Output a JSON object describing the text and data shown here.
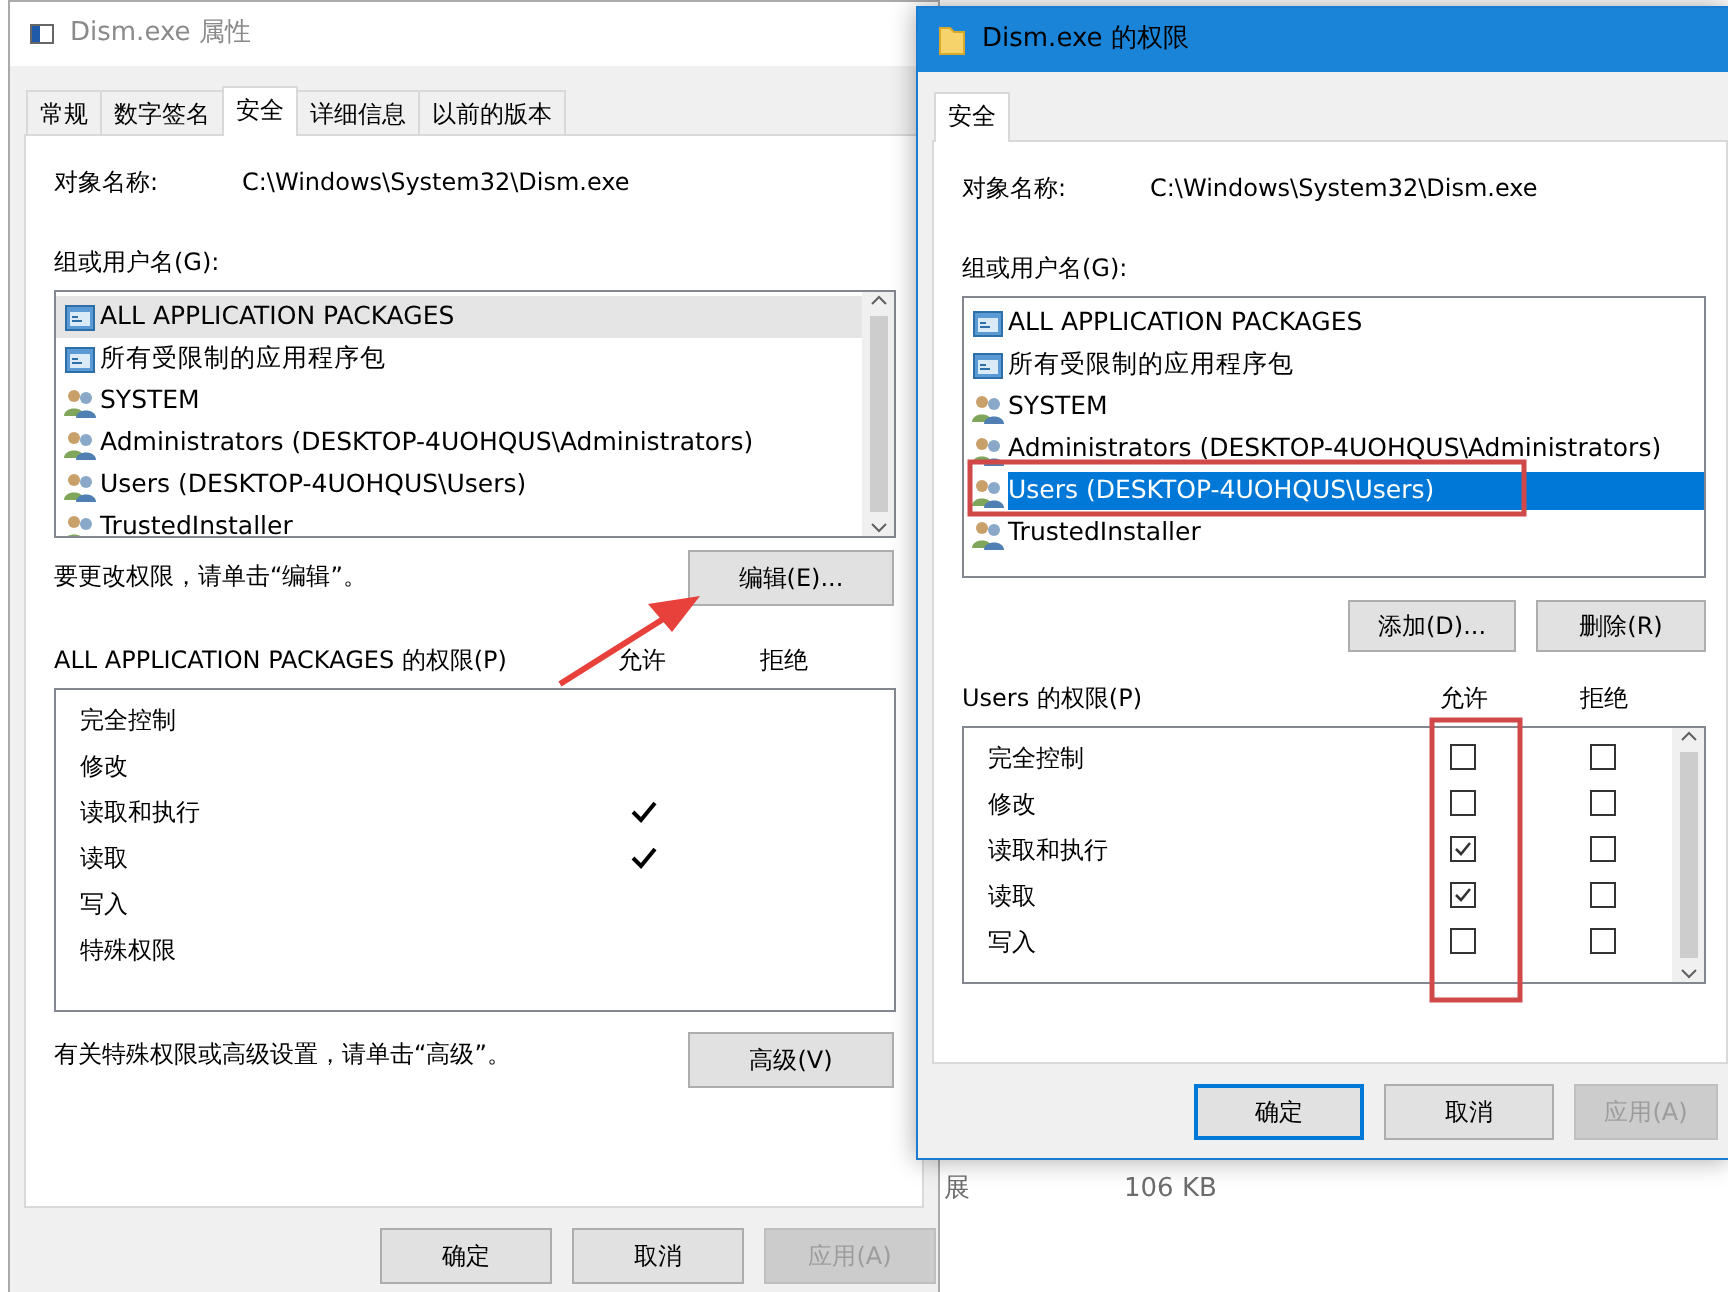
{
  "background": {
    "texts": [
      "展",
      "106 KB"
    ]
  },
  "left_window": {
    "title": "Dism.exe 属性",
    "active": false,
    "tabs": [
      {
        "label": "常规",
        "selected": false
      },
      {
        "label": "数字签名",
        "selected": false
      },
      {
        "label": "安全",
        "selected": true
      },
      {
        "label": "详细信息",
        "selected": false
      },
      {
        "label": "以前的版本",
        "selected": false
      }
    ],
    "object_label": "对象名称:",
    "object_value": "C:\\Windows\\System32\\Dism.exe",
    "groups_label": "组或用户名(G):",
    "groups": [
      {
        "name": "ALL APPLICATION PACKAGES",
        "kind": "package",
        "selected": true
      },
      {
        "name": "所有受限制的应用程序包",
        "kind": "package",
        "selected": false
      },
      {
        "name": "SYSTEM",
        "kind": "group",
        "selected": false
      },
      {
        "name": "Administrators (DESKTOP-4UOHQUS\\Administrators)",
        "kind": "group",
        "selected": false
      },
      {
        "name": "Users (DESKTOP-4UOHQUS\\Users)",
        "kind": "group",
        "selected": false
      },
      {
        "name": "TrustedInstaller",
        "kind": "group",
        "selected": false
      }
    ],
    "edit_hint": "要更改权限，请单击“编辑”。",
    "edit_button": "编辑(E)...",
    "permissions_title": "ALL APPLICATION PACKAGES 的权限(P)",
    "allow_header": "允许",
    "deny_header": "拒绝",
    "permissions": [
      {
        "name": "完全控制",
        "allow": false,
        "deny": false
      },
      {
        "name": "修改",
        "allow": false,
        "deny": false
      },
      {
        "name": "读取和执行",
        "allow": true,
        "deny": false
      },
      {
        "name": "读取",
        "allow": true,
        "deny": false
      },
      {
        "name": "写入",
        "allow": false,
        "deny": false
      },
      {
        "name": "特殊权限",
        "allow": false,
        "deny": false
      }
    ],
    "advanced_hint": "有关特殊权限或高级设置，请单击“高级”。",
    "advanced_button": "高级(V)",
    "buttons": [
      {
        "label": "确定",
        "disabled": false,
        "default": false
      },
      {
        "label": "取消",
        "disabled": false,
        "default": false
      },
      {
        "label": "应用(A)",
        "disabled": true,
        "default": false
      }
    ]
  },
  "right_window": {
    "title": "Dism.exe 的权限",
    "active": true,
    "tabs": [
      {
        "label": "安全",
        "selected": true
      }
    ],
    "object_label": "对象名称:",
    "object_value": "C:\\Windows\\System32\\Dism.exe",
    "groups_label": "组或用户名(G):",
    "groups": [
      {
        "name": "ALL APPLICATION PACKAGES",
        "kind": "package",
        "selected": false
      },
      {
        "name": "所有受限制的应用程序包",
        "kind": "package",
        "selected": false
      },
      {
        "name": "SYSTEM",
        "kind": "group",
        "selected": false
      },
      {
        "name": "Administrators (DESKTOP-4UOHQUS\\Administrators)",
        "kind": "group",
        "selected": false
      },
      {
        "name": "Users (DESKTOP-4UOHQUS\\Users)",
        "kind": "group",
        "selected": true
      },
      {
        "name": "TrustedInstaller",
        "kind": "group",
        "selected": false
      }
    ],
    "add_button": "添加(D)...",
    "remove_button": "删除(R)",
    "permissions_title": "Users 的权限(P)",
    "allow_header": "允许",
    "deny_header": "拒绝",
    "permissions": [
      {
        "name": "完全控制",
        "allow": false,
        "deny": false
      },
      {
        "name": "修改",
        "allow": false,
        "deny": false
      },
      {
        "name": "读取和执行",
        "allow": true,
        "deny": false
      },
      {
        "name": "读取",
        "allow": true,
        "deny": false
      },
      {
        "name": "写入",
        "allow": false,
        "deny": false
      }
    ],
    "buttons": [
      {
        "label": "确定",
        "disabled": false,
        "default": true
      },
      {
        "label": "取消",
        "disabled": false,
        "default": false
      },
      {
        "label": "应用(A)",
        "disabled": true,
        "default": false
      }
    ]
  }
}
